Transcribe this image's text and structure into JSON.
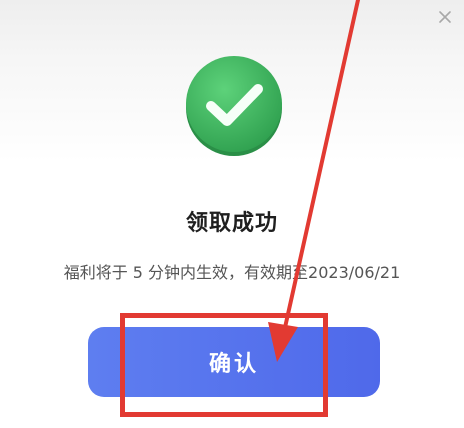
{
  "dialog": {
    "close_icon": "close-icon",
    "success_icon": "check-circle-icon",
    "title": "领取成功",
    "subtitle": "福利将于 5 分钟内生效，有效期至2023/06/21",
    "confirm_label": "确认"
  },
  "annotation": {
    "color": "#e23a32"
  },
  "colors": {
    "success_green": "#3fb95f",
    "button_blue": "#5675ee"
  }
}
